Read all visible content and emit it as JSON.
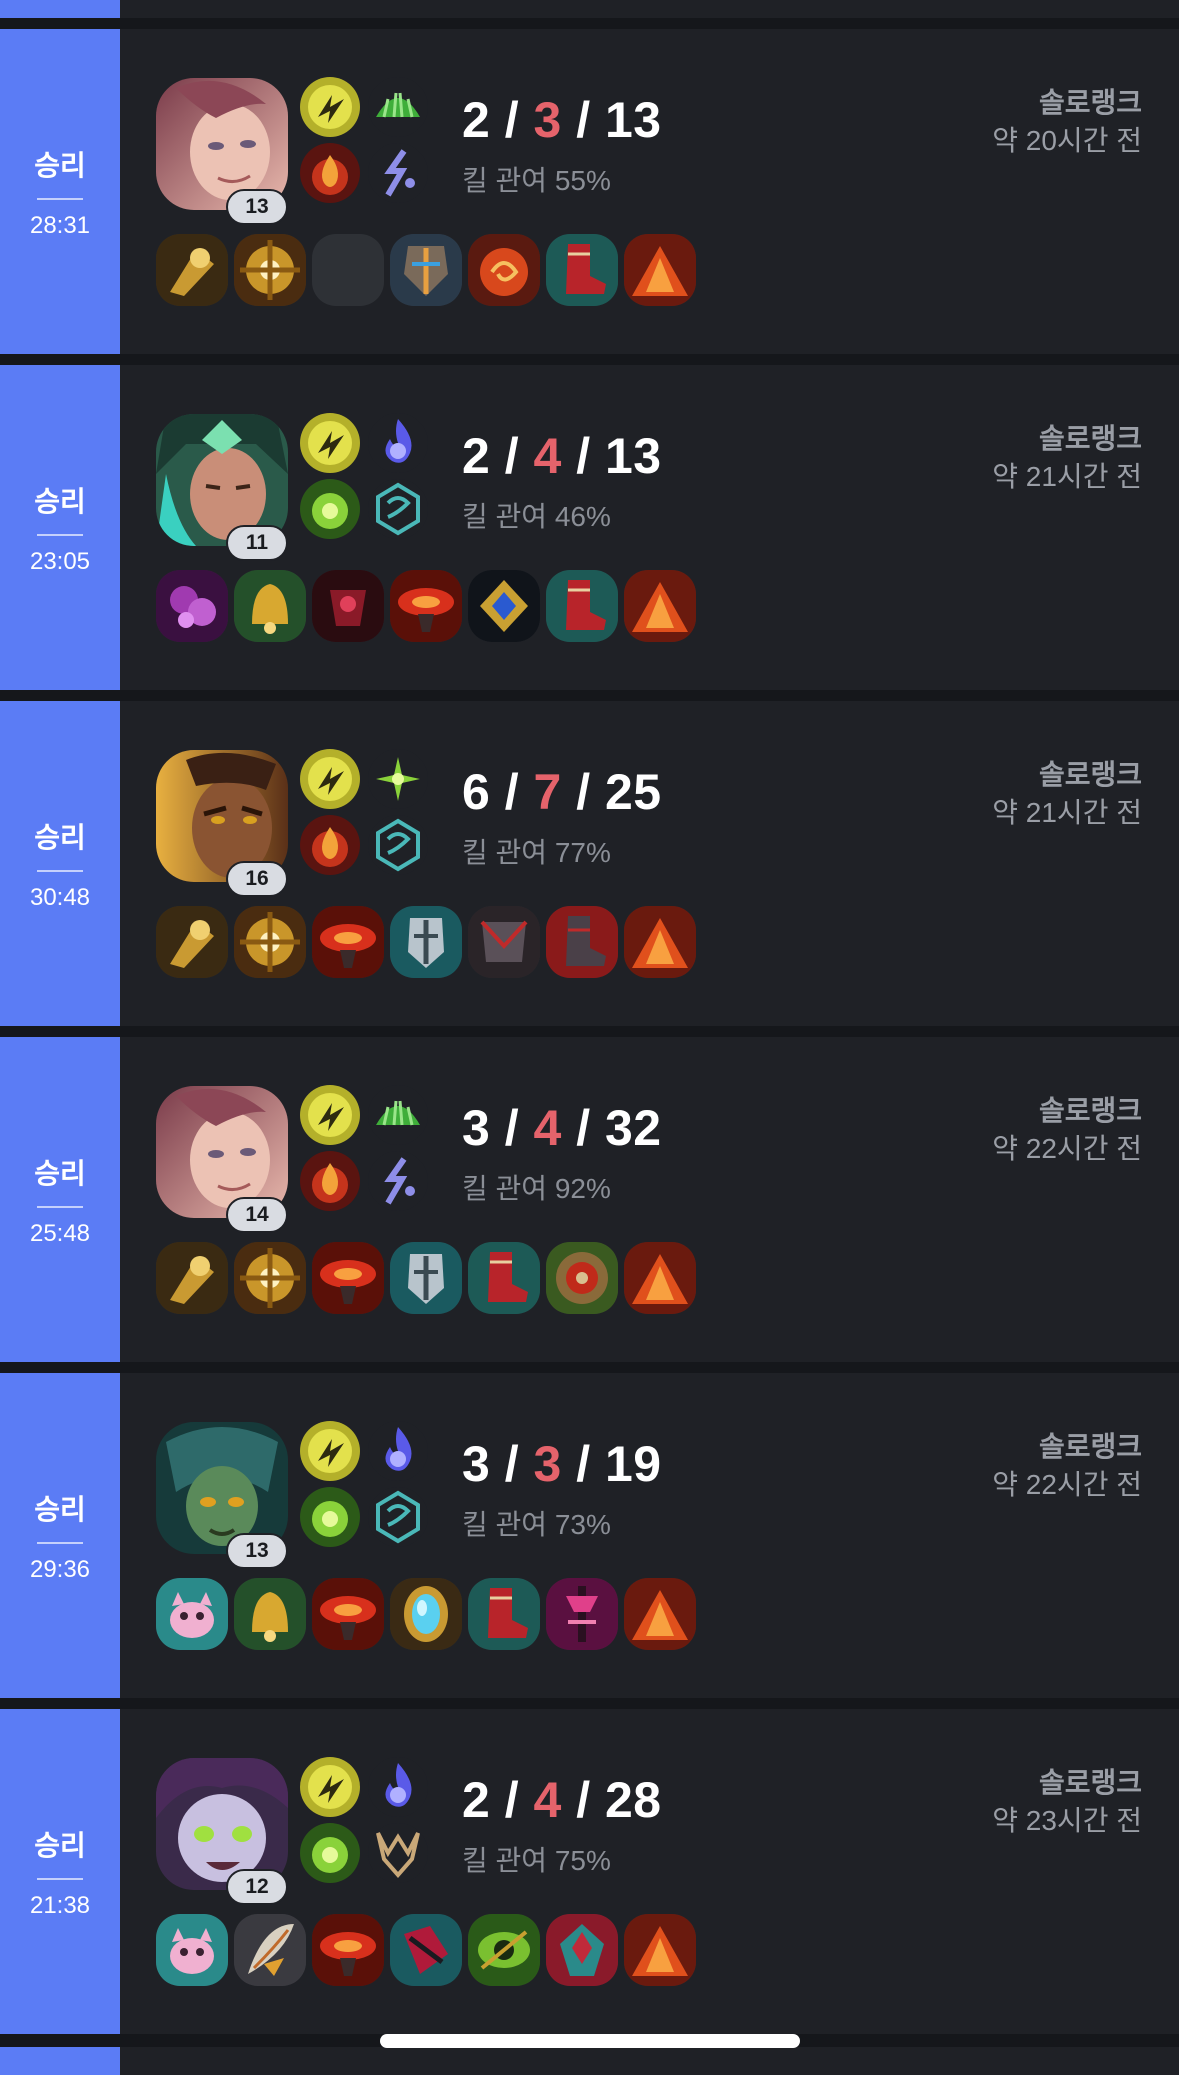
{
  "matches": [
    {
      "result": "승리",
      "duration": "28:31",
      "level": "13",
      "kills": "2",
      "deaths": "3",
      "assists": "13",
      "kill_participation": "킬 관여 55%",
      "queue": "솔로랭크",
      "time_ago": "약 20시간 전",
      "champion_icon": "champion-portrait-1",
      "spells": [
        "flash-spell-icon",
        "ignite-spell-icon"
      ],
      "runes": [
        "green-rune-icon",
        "purple-rune-icon"
      ],
      "items": [
        "gold-axe-item-icon",
        "gold-gear-item-icon",
        "empty-item-slot",
        "armor-item-icon",
        "red-orb-item-icon",
        "red-boots-item-icon",
        "red-trinket-item-icon"
      ]
    },
    {
      "result": "승리",
      "duration": "23:05",
      "level": "11",
      "kills": "2",
      "deaths": "4",
      "assists": "13",
      "kill_participation": "킬 관여 46%",
      "queue": "솔로랭크",
      "time_ago": "약 21시간 전",
      "champion_icon": "champion-portrait-2",
      "spells": [
        "flash-spell-icon",
        "green-spell-icon"
      ],
      "runes": [
        "blue-flame-rune-icon",
        "teal-rune-icon"
      ],
      "items": [
        "purple-item-icon",
        "gold-bell-item-icon",
        "dark-red-item-icon",
        "red-helmet-item-icon",
        "blue-gem-item-icon",
        "red-boots-item-icon",
        "red-trinket-item-icon"
      ]
    },
    {
      "result": "승리",
      "duration": "30:48",
      "level": "16",
      "kills": "6",
      "deaths": "7",
      "assists": "25",
      "kill_participation": "킬 관여 77%",
      "queue": "솔로랭크",
      "time_ago": "약 21시간 전",
      "champion_icon": "champion-portrait-3",
      "spells": [
        "flash-spell-icon",
        "ignite-spell-icon"
      ],
      "runes": [
        "green-star-rune-icon",
        "teal-rune-icon"
      ],
      "items": [
        "gold-axe-item-icon",
        "gold-gear-item-icon",
        "red-helmet-item-icon",
        "silver-armor-item-icon",
        "dark-armor-item-icon",
        "dark-boots-item-icon",
        "red-trinket-item-icon"
      ]
    },
    {
      "result": "승리",
      "duration": "25:48",
      "level": "14",
      "kills": "3",
      "deaths": "4",
      "assists": "32",
      "kill_participation": "킬 관여 92%",
      "queue": "솔로랭크",
      "time_ago": "약 22시간 전",
      "champion_icon": "champion-portrait-1",
      "spells": [
        "flash-spell-icon",
        "ignite-spell-icon"
      ],
      "runes": [
        "green-rune-icon",
        "purple-rune-icon"
      ],
      "items": [
        "gold-axe-item-icon",
        "gold-gear-item-icon",
        "red-helmet-item-icon",
        "silver-armor-item-icon",
        "red-boots-item-icon",
        "green-shield-item-icon",
        "red-trinket-item-icon"
      ]
    },
    {
      "result": "승리",
      "duration": "29:36",
      "level": "13",
      "kills": "3",
      "deaths": "3",
      "assists": "19",
      "kill_participation": "킬 관여 73%",
      "queue": "솔로랭크",
      "time_ago": "약 22시간 전",
      "champion_icon": "champion-portrait-4",
      "spells": [
        "flash-spell-icon",
        "green-spell-icon"
      ],
      "runes": [
        "blue-flame-rune-icon",
        "teal-rune-icon"
      ],
      "items": [
        "pink-pet-item-icon",
        "gold-bell-item-icon",
        "red-helmet-item-icon",
        "blue-mirror-item-icon",
        "red-boots-item-icon",
        "pink-staff-item-icon",
        "red-trinket-item-icon"
      ]
    },
    {
      "result": "승리",
      "duration": "21:38",
      "level": "12",
      "kills": "2",
      "deaths": "4",
      "assists": "28",
      "kill_participation": "킬 관여 75%",
      "queue": "솔로랭크",
      "time_ago": "약 23시간 전",
      "champion_icon": "champion-portrait-5",
      "spells": [
        "flash-spell-icon",
        "green-spell-icon"
      ],
      "runes": [
        "blue-flame-rune-icon",
        "bronze-rune-icon"
      ],
      "items": [
        "pink-pet-item-icon",
        "feather-item-icon",
        "red-helmet-item-icon",
        "crimson-item-icon",
        "green-eye-item-icon",
        "red-teal-item-icon",
        "red-trinket-item-icon"
      ]
    }
  ],
  "colors": {
    "win_accent": "#5b7cf5",
    "deaths": "#e5636b",
    "card_bg": "#1f2126",
    "page_bg": "#15171b"
  }
}
